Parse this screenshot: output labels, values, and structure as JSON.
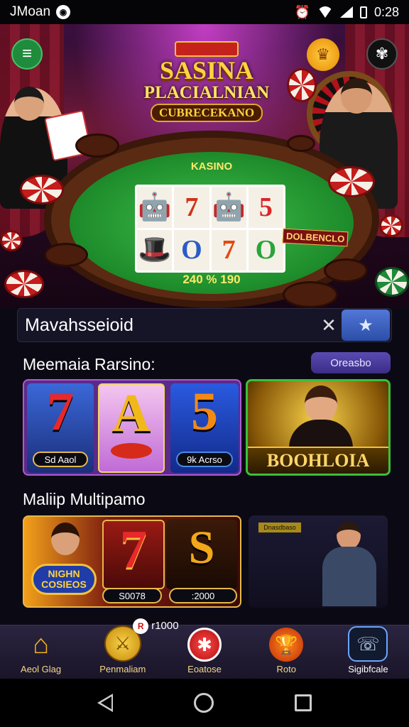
{
  "status_bar": {
    "carrier": "JMoan",
    "time": "0:28"
  },
  "hero": {
    "logo_line1": "SASINA",
    "logo_line2": "PLACIALNIAN",
    "logo_line3": "CUBRECEKANO",
    "table_title": "KASINO",
    "reel_symbols": [
      "🤖",
      "7",
      "🤖",
      "5",
      "🎩",
      "O",
      "7",
      "O"
    ],
    "bet_text": "240 % 190",
    "side_label": "DOLBENCLO"
  },
  "search": {
    "value": "Mavahsseioid"
  },
  "section1": {
    "title": "Meemaia Rarsino:",
    "pill_label": "Oreasbo",
    "tiles": [
      {
        "symbol": "7",
        "tag": "Sd Aaol"
      },
      {
        "symbol": "A",
        "tag": ""
      },
      {
        "symbol": "5",
        "tag": "9k Acrso"
      },
      {
        "banner": "BOOHLOIA"
      }
    ]
  },
  "section2": {
    "title": "Maliip Multipamo",
    "promo_label": "NIGHN COSIEOS",
    "symbol_a": "7",
    "symbol_b": "S",
    "tag_a": "S0078",
    "tag_b": ":2000",
    "mini_label": "Dnasdbaso"
  },
  "bottom_nav": {
    "badge_count": "R",
    "badge_text": "r1000",
    "items": [
      {
        "label": "Aeol Glag",
        "icon": "home-icon"
      },
      {
        "label": "Penmaliam",
        "icon": "coin-icon"
      },
      {
        "label": "Eoatose",
        "icon": "chip-icon"
      },
      {
        "label": "Roto",
        "icon": "trophy-icon"
      },
      {
        "label": "Sigibfcale",
        "icon": "support-icon"
      }
    ]
  },
  "colors": {
    "accent_blue": "#3b5fc4",
    "gold": "#f4c13a",
    "felt_green": "#2aa53a"
  }
}
